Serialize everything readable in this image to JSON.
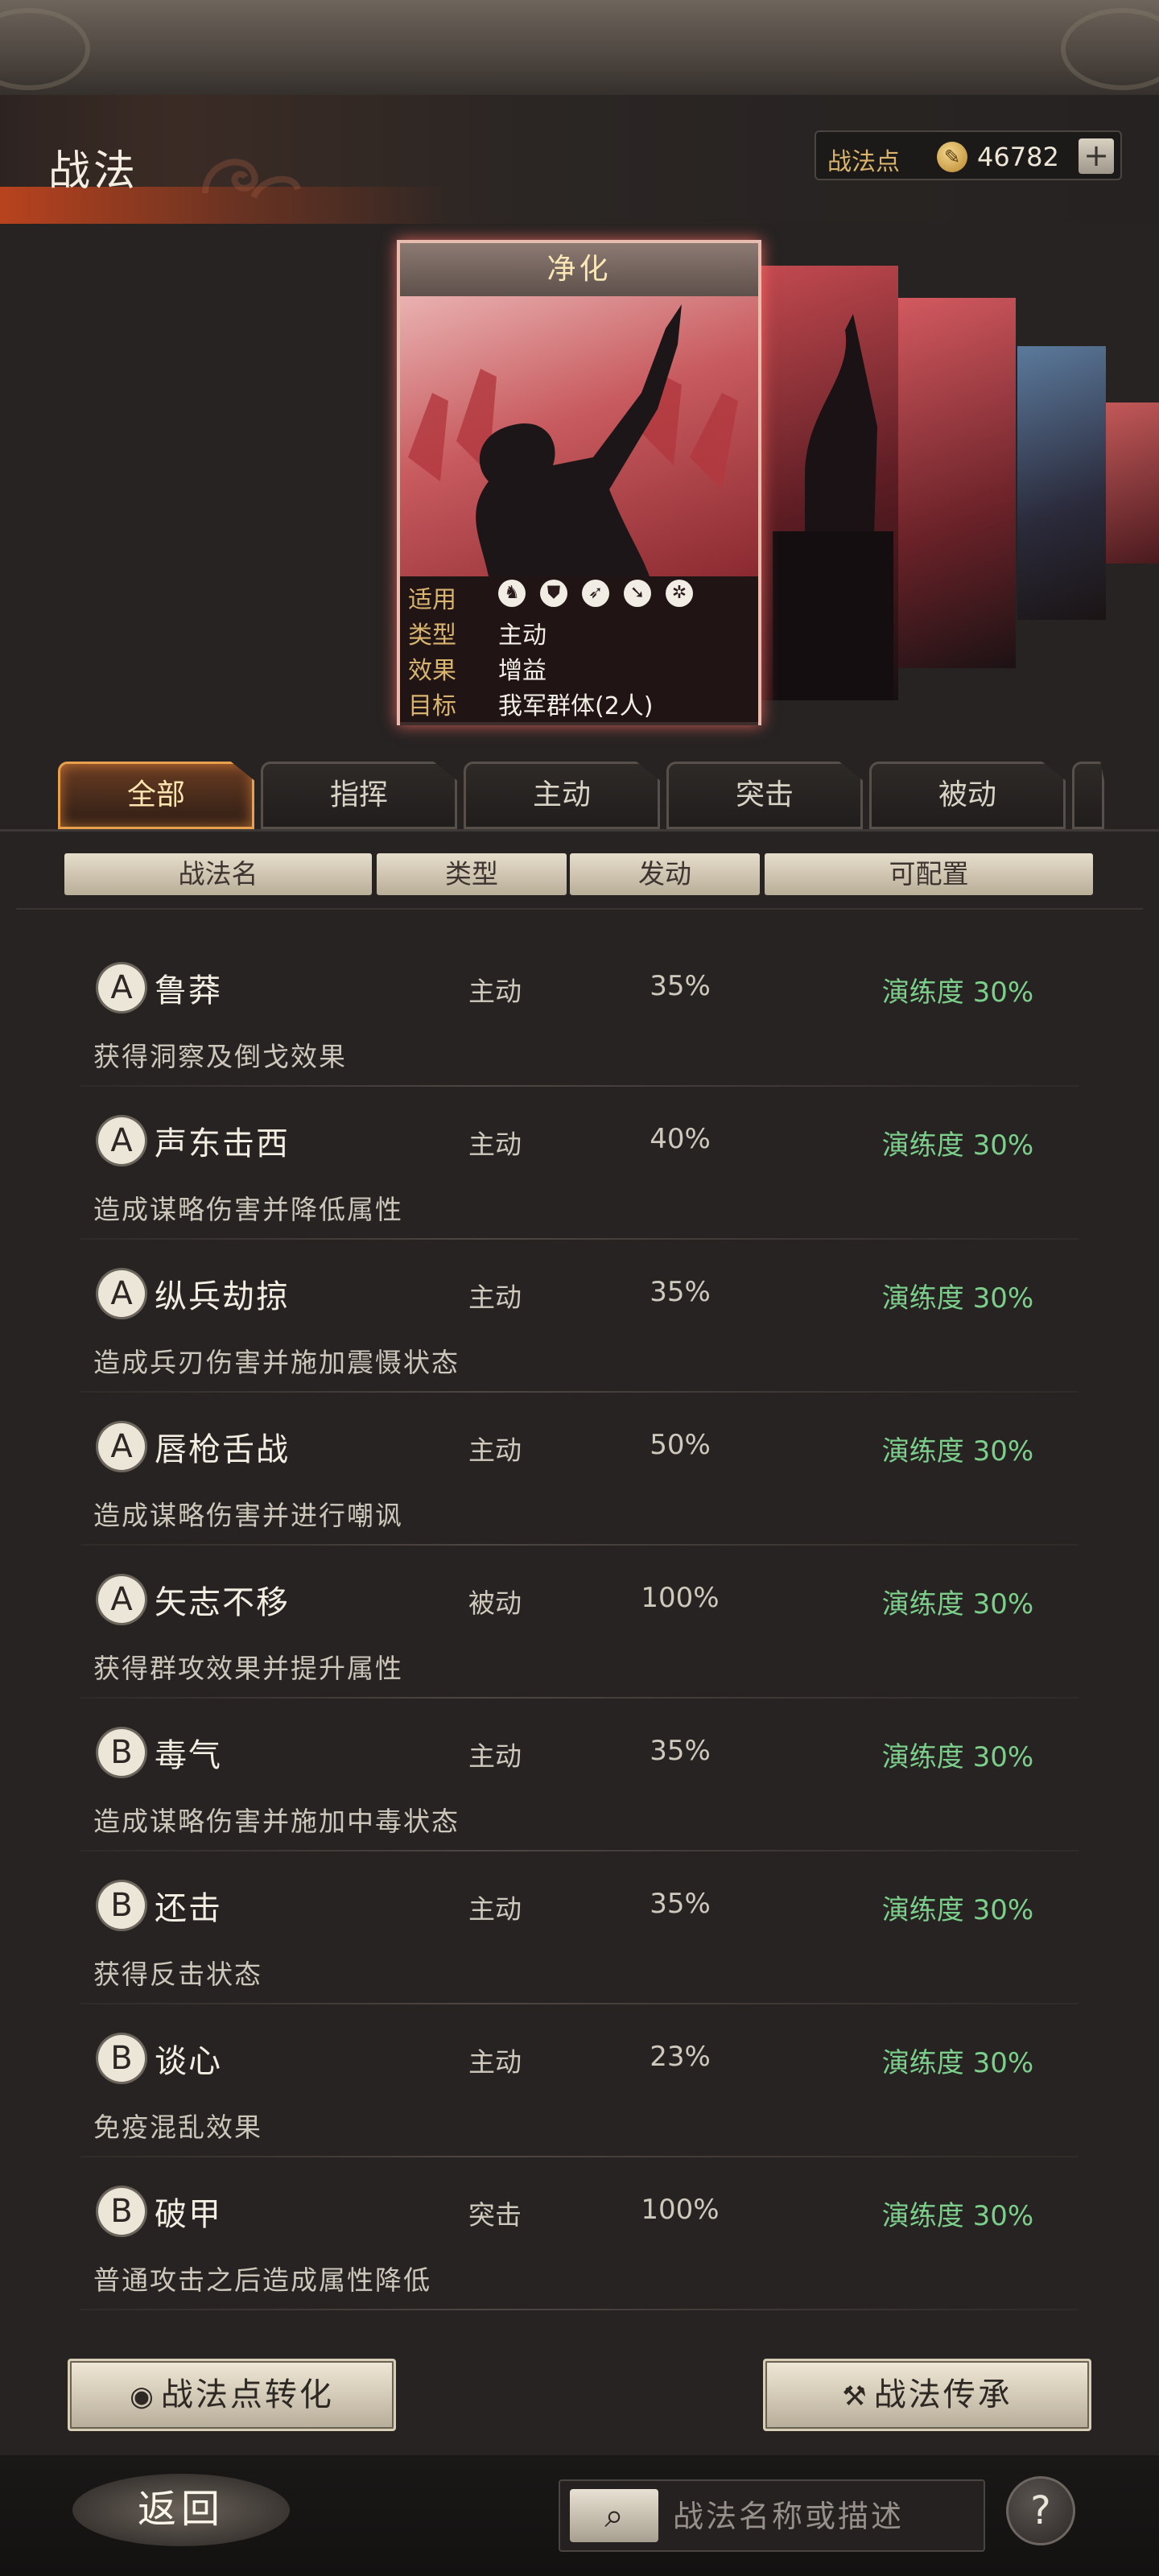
{
  "header": {
    "title": "战法",
    "points_label": "战法点",
    "points_value": "46782",
    "points_add": "+"
  },
  "featured_card": {
    "name": "净化",
    "rows": [
      {
        "key": "适用",
        "value": ""
      },
      {
        "key": "类型",
        "value": "主动"
      },
      {
        "key": "效果",
        "value": "增益"
      },
      {
        "key": "目标",
        "value": "我军群体(2人)"
      }
    ],
    "unit_icons": [
      "cavalry-icon",
      "shield-icon",
      "bow-icon",
      "spear-icon",
      "wheel-icon"
    ]
  },
  "tabs": [
    {
      "label": "全部",
      "active": true
    },
    {
      "label": "指挥",
      "active": false
    },
    {
      "label": "主动",
      "active": false
    },
    {
      "label": "突击",
      "active": false
    },
    {
      "label": "被动",
      "active": false
    }
  ],
  "columns": {
    "name": "战法名",
    "type": "类型",
    "rate": "发动",
    "config": "可配置"
  },
  "skills": [
    {
      "grade": "A",
      "name": "鲁莽",
      "type": "主动",
      "rate": "35%",
      "train": "演练度 30%",
      "desc": "获得洞察及倒戈效果"
    },
    {
      "grade": "A",
      "name": "声东击西",
      "type": "主动",
      "rate": "40%",
      "train": "演练度 30%",
      "desc": "造成谋略伤害并降低属性"
    },
    {
      "grade": "A",
      "name": "纵兵劫掠",
      "type": "主动",
      "rate": "35%",
      "train": "演练度 30%",
      "desc": "造成兵刃伤害并施加震慑状态"
    },
    {
      "grade": "A",
      "name": "唇枪舌战",
      "type": "主动",
      "rate": "50%",
      "train": "演练度 30%",
      "desc": "造成谋略伤害并进行嘲讽"
    },
    {
      "grade": "A",
      "name": "矢志不移",
      "type": "被动",
      "rate": "100%",
      "train": "演练度 30%",
      "desc": "获得群攻效果并提升属性"
    },
    {
      "grade": "B",
      "name": "毒气",
      "type": "主动",
      "rate": "35%",
      "train": "演练度 30%",
      "desc": "造成谋略伤害并施加中毒状态"
    },
    {
      "grade": "B",
      "name": "还击",
      "type": "主动",
      "rate": "35%",
      "train": "演练度 30%",
      "desc": "获得反击状态"
    },
    {
      "grade": "B",
      "name": "谈心",
      "type": "主动",
      "rate": "23%",
      "train": "演练度 30%",
      "desc": "免疫混乱效果"
    },
    {
      "grade": "B",
      "name": "破甲",
      "type": "突击",
      "rate": "100%",
      "train": "演练度 30%",
      "desc": "普通攻击之后造成属性降低"
    }
  ],
  "actions": {
    "convert_label": "战法点转化",
    "inherit_label": "战法传承"
  },
  "footer": {
    "back_label": "返回",
    "search_placeholder": "战法名称或描述",
    "help_label": "?"
  },
  "colors": {
    "accent_orange": "#e8a04c",
    "train_green": "#7ccf8a",
    "gold": "#d9b46a"
  }
}
